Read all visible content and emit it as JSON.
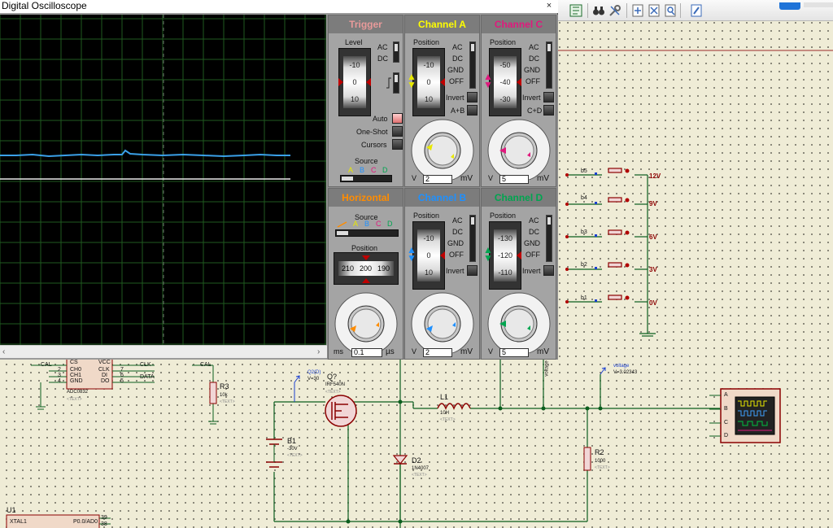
{
  "oscilloscope": {
    "title": "Digital Oscilloscope",
    "close_label": "×",
    "trigger": {
      "title": "Trigger",
      "level_label": "Level",
      "level_ticks": [
        "-10",
        "0",
        "10"
      ],
      "coupling": [
        "AC",
        "DC"
      ],
      "modes": [
        "Auto",
        "One-Shot",
        "Cursors"
      ],
      "source_label": "Source",
      "source_options": [
        "A",
        "B",
        "C",
        "D"
      ]
    },
    "channel_a": {
      "title": "Channel A",
      "color": "#ffff00",
      "position_label": "Position",
      "ticks": [
        "-10",
        "0",
        "10"
      ],
      "coupling": [
        "AC",
        "DC",
        "GND",
        "OFF"
      ],
      "invert_label": "Invert",
      "combine_label": "A+B",
      "scale_value": "2",
      "scale_unit": "mV",
      "volt_label": "V",
      "knob_labels": [
        "0.5",
        "0.2",
        "0.1",
        "1",
        "50",
        "2",
        "20",
        "5",
        "10",
        "10",
        "5",
        "20",
        "2"
      ]
    },
    "channel_b": {
      "title": "Channel B",
      "color": "#1e90ff",
      "position_label": "Position",
      "ticks": [
        "-10",
        "0",
        "10"
      ],
      "coupling": [
        "AC",
        "DC",
        "GND",
        "OFF"
      ],
      "invert_label": "Invert",
      "scale_value": "2",
      "scale_unit": "mV",
      "volt_label": "V"
    },
    "channel_c": {
      "title": "Channel C",
      "color": "#e0197d",
      "position_label": "Position",
      "ticks": [
        "-50",
        "-40",
        "-30"
      ],
      "coupling": [
        "AC",
        "DC",
        "GND",
        "OFF"
      ],
      "invert_label": "Invert",
      "combine_label": "C+D",
      "scale_value": "5",
      "scale_unit": "mV",
      "volt_label": "V"
    },
    "channel_d": {
      "title": "Channel D",
      "color": "#00a550",
      "position_label": "Position",
      "ticks": [
        "-130",
        "-120",
        "-110"
      ],
      "coupling": [
        "AC",
        "DC",
        "GND",
        "OFF"
      ],
      "invert_label": "Invert",
      "scale_value": "5",
      "scale_unit": "mV",
      "volt_label": "V"
    },
    "horizontal": {
      "title": "Horizontal",
      "color": "#ff8c00",
      "source_label": "Source",
      "source_options": [
        "A",
        "B",
        "C",
        "D"
      ],
      "position_label": "Position",
      "ticks": [
        "210",
        "200",
        "190"
      ],
      "time_value": "0.1",
      "time_unit": "µs",
      "ms_label": "ms",
      "knob_labels": [
        "0.5",
        "0.2",
        "0.1",
        "1",
        "50",
        "2",
        "20",
        "5",
        "10",
        "10",
        "5",
        "20",
        "2",
        "50",
        "1",
        "100",
        "0.5",
        "200"
      ]
    }
  },
  "schematic": {
    "switch_labels": [
      "b5",
      "b4",
      "b3",
      "b2",
      "b1"
    ],
    "supply_labels": [
      "12V",
      "9V",
      "6V",
      "3V",
      "0V"
    ],
    "components": {
      "adc": {
        "ref": "ADC0832",
        "pins_left": [
          "CS",
          "CH0",
          "CH1",
          "GND"
        ],
        "pins_right": [
          "VCC",
          "CLK",
          "DI",
          "DO"
        ],
        "pin_nums_left": [
          "2",
          "3",
          "4"
        ],
        "pin_nums_right": [
          "7",
          "6",
          "5"
        ],
        "text": "<TEXT>"
      },
      "cal_net": "CAL",
      "clk_net": "CLK",
      "data_net": "DATA",
      "r3": {
        "ref": "R3",
        "value": "10k"
      },
      "q2": {
        "probe": "Q2(D)",
        "probe_value": "V=30",
        "ref": "Q?",
        "part": "IRF540N"
      },
      "b1": {
        "ref": "B1",
        "value": "-30V"
      },
      "d2": {
        "ref": "D2",
        "part": "1N4007"
      },
      "l1": {
        "ref": "L1",
        "value": "10H"
      },
      "r2": {
        "ref": "R2",
        "value": "1000"
      },
      "voltage_probe": {
        "name": "voltage",
        "value": "V=3.02343"
      },
      "u1": {
        "ref": "U1",
        "pin_left": "XTAL1",
        "pin_right": "P0.0/AD0",
        "pin_nums": [
          "39",
          "38"
        ]
      },
      "scope_inputs": [
        "A",
        "B",
        "C",
        "D"
      ],
      "placeholder_text": "<TEXT>"
    }
  },
  "toolbar": {
    "icons": [
      "wire-label-icon",
      "binoculars-icon",
      "tools-icon",
      "new-sheet-icon",
      "remove-sheet-icon",
      "zoom-sheet-icon",
      "edit-icon"
    ]
  }
}
